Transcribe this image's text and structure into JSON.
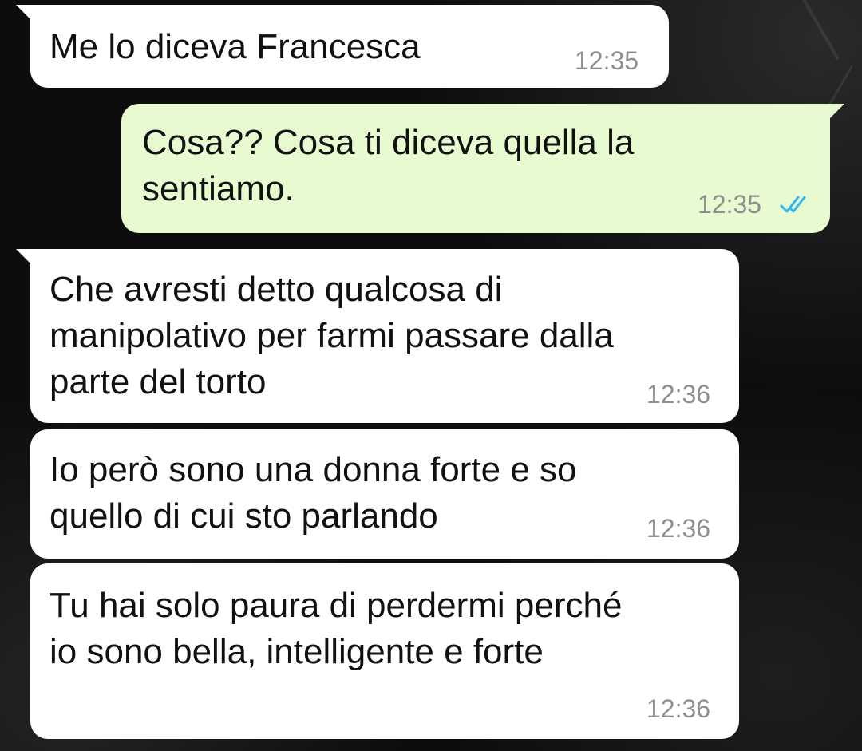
{
  "messages": [
    {
      "direction": "incoming",
      "text": "Me lo diceva Francesca",
      "time": "12:35"
    },
    {
      "direction": "outgoing",
      "text": "Cosa?? Cosa ti diceva quella la\nsentiamo.",
      "time": "12:35",
      "status": "read"
    },
    {
      "direction": "incoming",
      "text": "Che avresti detto qualcosa di\nmanipolativo per farmi passare dalla\nparte del torto",
      "time": "12:36"
    },
    {
      "direction": "incoming",
      "text": "Io però sono una donna forte e so\nquello di cui sto parlando",
      "time": "12:36"
    },
    {
      "direction": "incoming",
      "text": "Tu hai solo paura di perdermi perché\nio sono bella, intelligente e forte",
      "time": "12:36"
    }
  ],
  "colors": {
    "incoming_bubble": "#ffffff",
    "outgoing_bubble": "#e8fbd0",
    "timestamp": "#8f8f8f",
    "read_ticks": "#34b7f1",
    "background": "#0d0d0d"
  },
  "icons": {
    "read_status": "double-check-icon"
  }
}
